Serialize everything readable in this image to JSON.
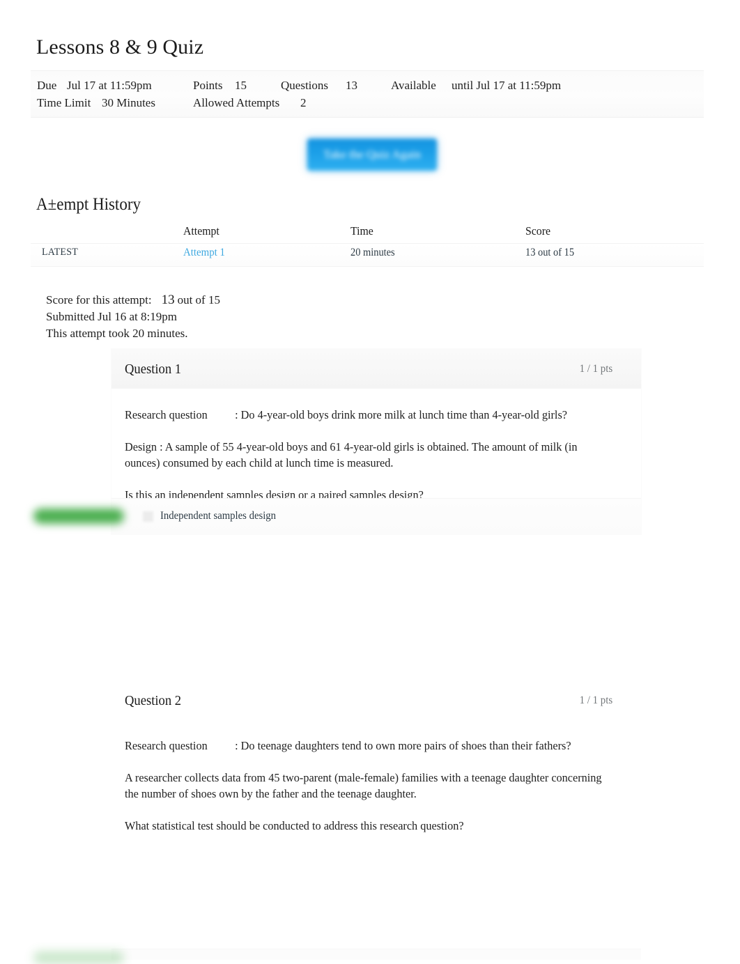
{
  "quiz": {
    "title": "Lessons 8 & 9 Quiz"
  },
  "meta": {
    "due_label": "Due",
    "due_value": "Jul 17 at 11:59pm",
    "points_label": "Points",
    "points_value": "15",
    "questions_label": "Questions",
    "questions_value": "13",
    "available_label": "Available",
    "available_value": "until Jul 17 at 11:59pm",
    "time_limit_label": "Time Limit",
    "time_limit_value": "30 Minutes",
    "allowed_attempts_label": "Allowed Attempts",
    "allowed_attempts_value": "2"
  },
  "actions": {
    "retake_label": "Take the Quiz Again"
  },
  "attempt_history": {
    "heading": "A±empt History",
    "columns": {
      "blank": "",
      "attempt": "Attempt",
      "time": "Time",
      "score": "Score"
    },
    "rows": [
      {
        "latest": "LATEST",
        "attempt": "Attempt 1",
        "time": "20 minutes",
        "score": "13 out of 15"
      }
    ]
  },
  "attempt_summary": {
    "score_label": "Score for this attempt:",
    "score_value": "13",
    "score_total": "out of 15",
    "submitted": "Submitted Jul 16 at 8:19pm",
    "duration": "This attempt took 20 minutes."
  },
  "questions": [
    {
      "title": "Question 1",
      "points": "1 / 1 pts",
      "research_label": "Research question",
      "research_text": ": Do 4-year-old boys drink more milk at lunch time than 4-year-old girls?",
      "design_text": "Design  : A sample of 55 4-year-old boys and 61 4-year-old girls is obtained. The amount of milk (in ounces) consumed by each child at lunch time is measured.",
      "prompt": "Is this an independent samples design or a paired samples design?",
      "answer": "Independent samples design"
    },
    {
      "title": "Question 2",
      "points": "1 / 1 pts",
      "research_label": "Research question",
      "research_text": ": Do teenage daughters tend to own more pairs of shoes than their fathers?",
      "design_text": "A researcher collects data from 45 two-parent (male-female) families with a teenage daughter concerning the number of shoes own by the father and the teenage daughter.",
      "prompt": "What statistical test should be conducted to address this research question?"
    }
  ],
  "colors": {
    "link": "#3da8e0",
    "button": "#1b9fe8",
    "correct": "#4caf50",
    "text": "#1f1f1f",
    "muted": "#73777a"
  }
}
